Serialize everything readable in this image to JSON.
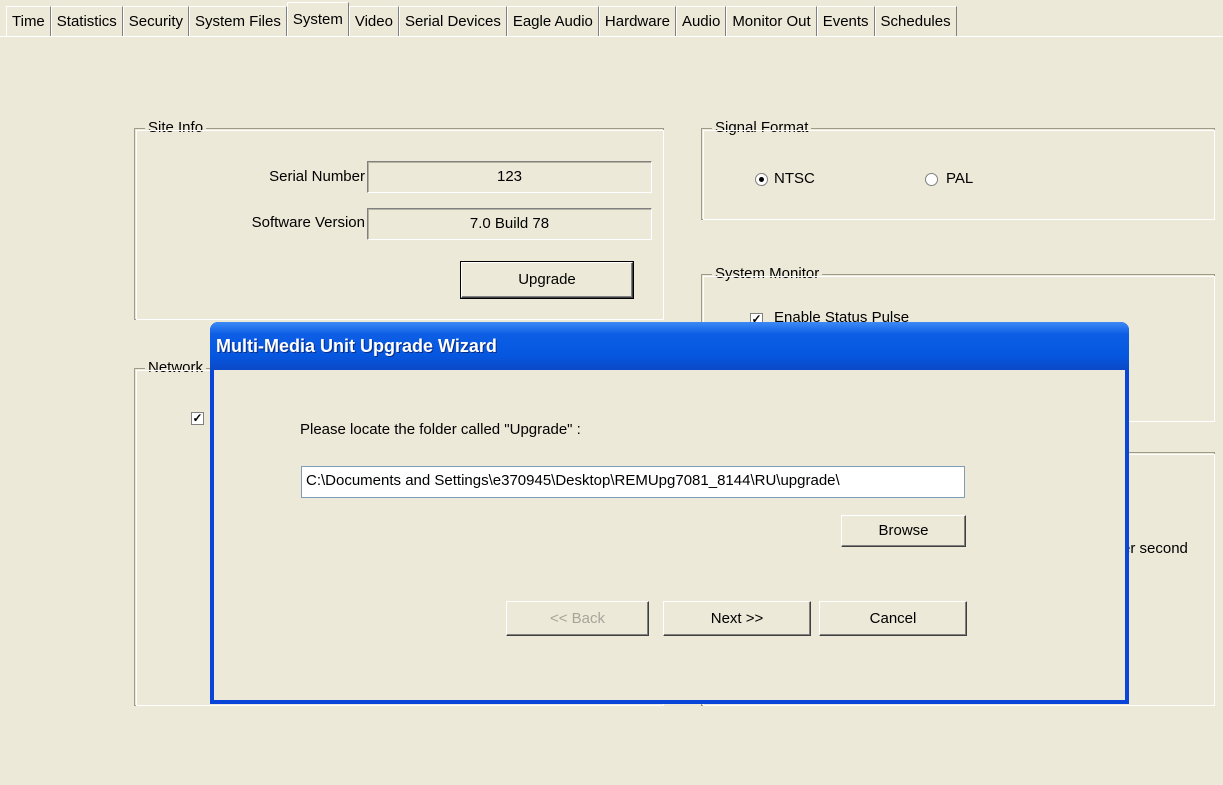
{
  "tabs": [
    "Time",
    "Statistics",
    "Security",
    "System Files",
    "System",
    "Video",
    "Serial Devices",
    "Eagle Audio",
    "Hardware",
    "Audio",
    "Monitor Out",
    "Events",
    "Schedules"
  ],
  "active_tab": "System",
  "site_info": {
    "legend": "Site Info",
    "serial_label": "Serial Number",
    "serial_value": "123",
    "version_label": "Software Version",
    "version_value": "7.0 Build 78",
    "upgrade_button": "Upgrade"
  },
  "network": {
    "legend": "Network"
  },
  "signal_format": {
    "legend": "Signal Format",
    "ntsc": "NTSC",
    "pal": "PAL",
    "selected": "NTSC"
  },
  "system_monitor": {
    "legend": "System Monitor",
    "enable_status_pulse": "Enable Status Pulse"
  },
  "partial_text": "er second",
  "wizard": {
    "title": "Multi-Media Unit Upgrade Wizard",
    "prompt": "Please locate the folder called \"Upgrade\" :",
    "path_value": "C:\\Documents and Settings\\e370945\\Desktop\\REMUpg7081_8144\\RU\\upgrade\\",
    "browse": "Browse",
    "back": "<< Back",
    "next": "Next >>",
    "cancel": "Cancel"
  }
}
